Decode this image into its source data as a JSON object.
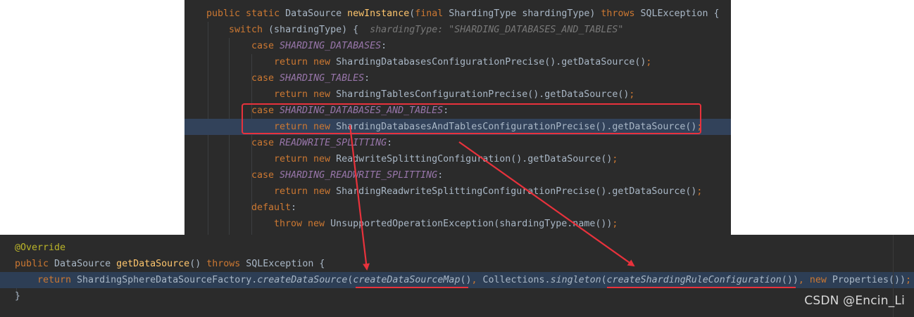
{
  "top_code": {
    "l1": {
      "kw1": "public static ",
      "t1": "DataSource ",
      "fn": "newInstance",
      "t2": "(",
      "kw2": "final ",
      "t3": "ShardingType shardingType) ",
      "kw3": "throws ",
      "t4": "SQLException {"
    },
    "l2": {
      "kw": "switch ",
      "t": "(shardingType) {  ",
      "hint": "shardingType: \"SHARDING_DATABASES_AND_TABLES\""
    },
    "l3": {
      "kw": "case ",
      "cst": "SHARDING_DATABASES",
      "t": ":"
    },
    "l4": {
      "kw": "return new ",
      "t": "ShardingDatabasesConfigurationPrecise().getDataSource()",
      "semi": ";"
    },
    "l5": {
      "kw": "case ",
      "cst": "SHARDING_TABLES",
      "t": ":"
    },
    "l6": {
      "kw": "return new ",
      "t": "ShardingTablesConfigurationPrecise().getDataSource()",
      "semi": ";"
    },
    "l7": {
      "kw": "case ",
      "cst": "SHARDING_DATABASES_AND_TABLES",
      "t": ":"
    },
    "l8": {
      "kw": "return new ",
      "t": "ShardingDatabasesAndTablesConfigurationPrecise().getDataSource()",
      "semi": ";"
    },
    "l9": {
      "kw": "case ",
      "cst": "READWRITE_SPLITTING",
      "t": ":"
    },
    "l10": {
      "kw": "return new ",
      "t": "ReadwriteSplittingConfiguration().getDataSource()",
      "semi": ";"
    },
    "l11": {
      "kw": "case ",
      "cst": "SHARDING_READWRITE_SPLITTING",
      "t": ":"
    },
    "l12": {
      "kw": "return new ",
      "t": "ShardingReadwriteSplittingConfigurationPrecise().getDataSource()",
      "semi": ";"
    },
    "l13": {
      "kw": "default",
      "t": ":"
    },
    "l14": {
      "kw1": "throw ",
      "kw2": "new ",
      "t": "UnsupportedOperationException(shardingType.name())",
      "semi": ";"
    }
  },
  "bottom_code": {
    "b1": {
      "ann": "@Override"
    },
    "b2": {
      "kw1": "public ",
      "t1": "DataSource ",
      "fn": "getDataSource",
      "t2": "() ",
      "kw2": "throws ",
      "t3": "SQLException {"
    },
    "b3": {
      "kw1": "return ",
      "t1": "ShardingSphereDataSourceFactory.",
      "it1": "createDataSource",
      "t2": "(",
      "it2": "createDataSourceMap",
      "t3": "()",
      "comma1": ", ",
      "t4": "Collections.",
      "it3": "singleton",
      "t5": "(",
      "it4": "createShardingRuleConfiguration",
      "t6": "())",
      "comma2": ", ",
      "kw2": "new ",
      "t7": "Properties())",
      "semi": ";"
    },
    "b4": {
      "t": "}"
    }
  },
  "watermark": "CSDN @Encin_Li",
  "colors": {
    "background": "#2b2b2b",
    "keyword": "#cc7832",
    "function": "#ffc66d",
    "constant": "#9876aa",
    "annotation": "#bbb529",
    "annotation_red": "#e8323c"
  }
}
